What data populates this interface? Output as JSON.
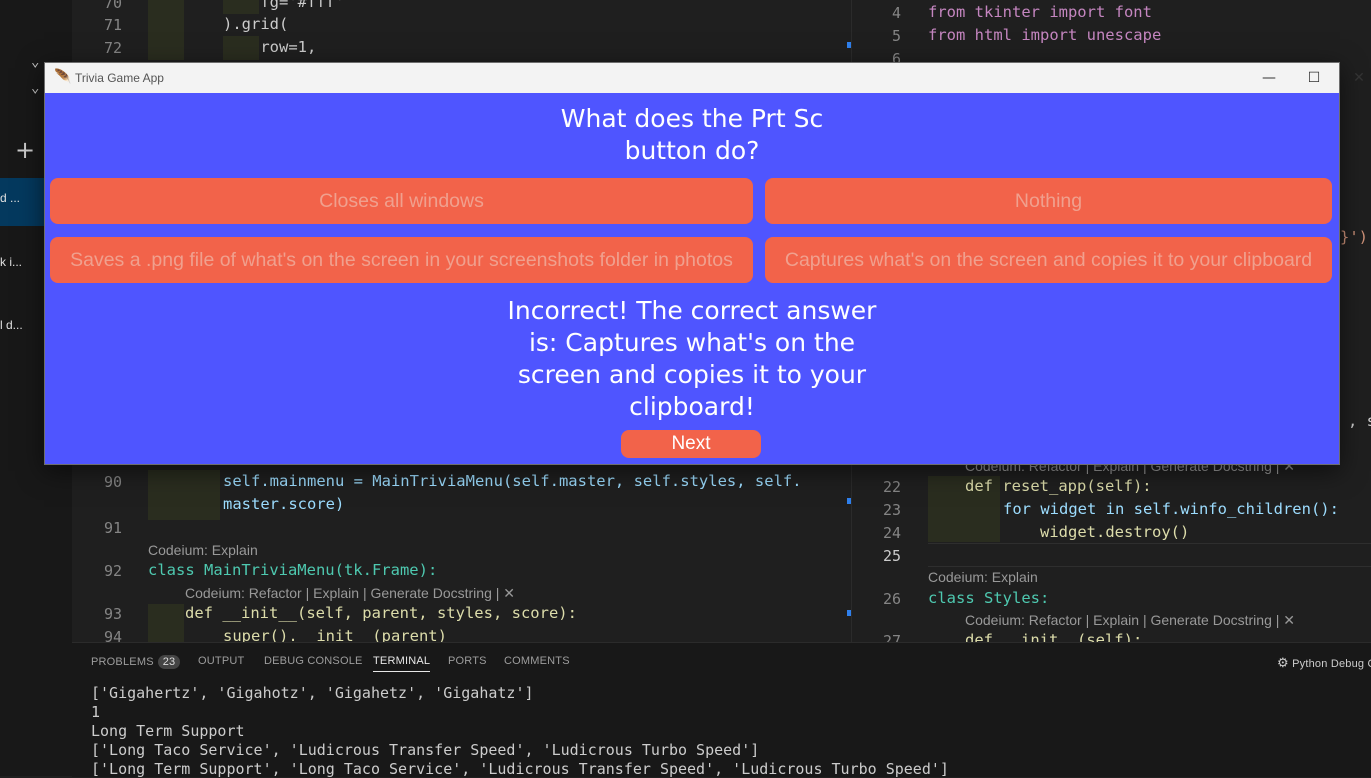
{
  "window": {
    "title": "Trivia Game App",
    "minimize": "—",
    "maximize": "☐",
    "close": "✕"
  },
  "trivia": {
    "question": "What does the Prt Sc button do?",
    "answers": [
      "Closes all windows",
      "Nothing",
      "Saves a .png file of what's on the screen in your screenshots folder in photos",
      "Captures what's on the screen and copies it to your clipboard"
    ],
    "result": "Incorrect! The correct answer is:  Captures what's on the screen and copies it to your clipboard!",
    "next_label": "Next"
  },
  "sidebar": {
    "items": [
      "d ...",
      "k i...",
      "l d..."
    ],
    "add": "+",
    "chevron": "⌄"
  },
  "editor_left": {
    "lines": [
      {
        "n": "70",
        "code": "    fg='#fff'"
      },
      {
        "n": "71",
        "code": ").grid("
      },
      {
        "n": "72",
        "code": "    row=1,"
      },
      {
        "n": "90",
        "code": "self.mainmenu = MainTriviaMenu(self.master, self.styles, self."
      },
      {
        "n": "",
        "code": "master.score)"
      },
      {
        "n": "91",
        "code": ""
      },
      {
        "n": "92",
        "code": "class MainTriviaMenu(tk.Frame):"
      },
      {
        "n": "93",
        "code": "def __init__(self, parent, styles, score):"
      },
      {
        "n": "94",
        "code": "super().__init__(parent)"
      }
    ],
    "lens": [
      "Codeium: Explain",
      "Codeium: Refactor | Explain | Generate Docstring | ✕"
    ]
  },
  "editor_right": {
    "lines": [
      {
        "n": "4",
        "code": "from tkinter import font"
      },
      {
        "n": "5",
        "code": "from html import unescape"
      },
      {
        "n": "6",
        "code": ""
      },
      {
        "n": "22",
        "code": "def reset_app(self):"
      },
      {
        "n": "23",
        "code": "for widget in self.winfo_children():"
      },
      {
        "n": "24",
        "code": "widget.destroy()"
      },
      {
        "n": "25",
        "code": ""
      },
      {
        "n": "26",
        "code": "class Styles:"
      },
      {
        "n": "27",
        "code": "def __init__(self):"
      }
    ],
    "lens": [
      "Codeium: Refactor | Explain | Generate Docstring | ✕",
      "Codeium: Explain",
      "Codeium: Refactor | Explain | Generate Docstring | ✕"
    ],
    "fragments": [
      "}')",
      ", se"
    ]
  },
  "panel": {
    "tabs": [
      "PROBLEMS",
      "OUTPUT",
      "DEBUG CONSOLE",
      "TERMINAL",
      "PORTS",
      "COMMENTS"
    ],
    "problems_count": "23",
    "debug_label": "Python Debug C",
    "terminal": [
      "['Gigahertz', 'Gigahotz', 'Gigahetz', 'Gigahatz']",
      "1",
      "Long Term Support",
      "['Long Taco Service', 'Ludicrous Transfer Speed', 'Ludicrous Turbo Speed']",
      "['Long Term Support', 'Long Taco Service', 'Ludicrous Transfer Speed', 'Ludicrous Turbo Speed']"
    ]
  }
}
